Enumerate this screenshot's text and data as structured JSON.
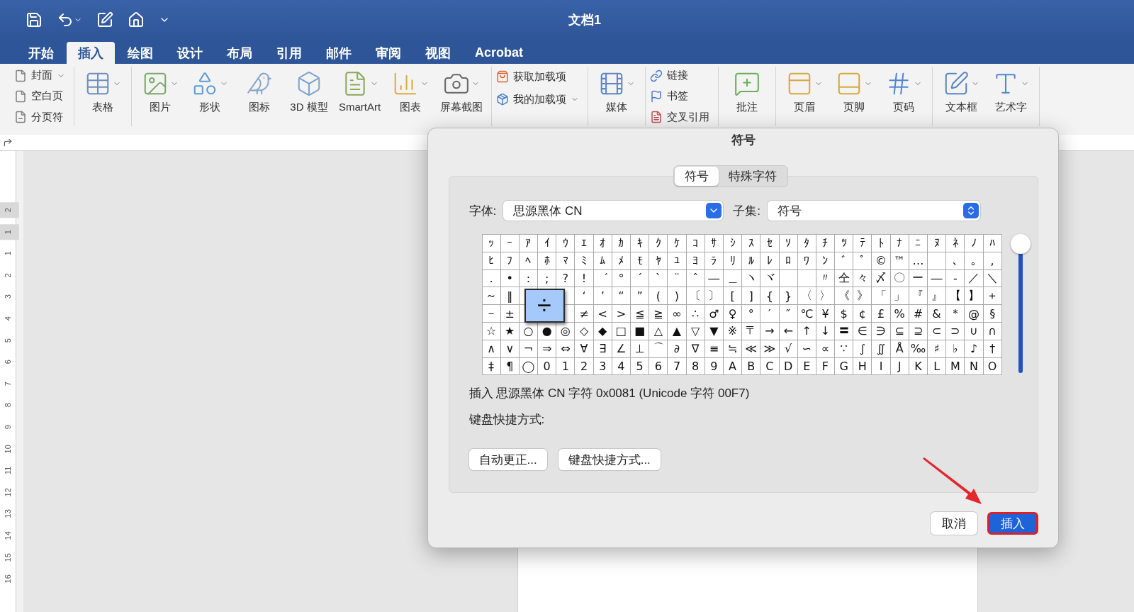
{
  "window": {
    "title": "文档1"
  },
  "menu_tabs": [
    {
      "label": "开始",
      "selected": false
    },
    {
      "label": "插入",
      "selected": true
    },
    {
      "label": "绘图",
      "selected": false
    },
    {
      "label": "设计",
      "selected": false
    },
    {
      "label": "布局",
      "selected": false
    },
    {
      "label": "引用",
      "selected": false
    },
    {
      "label": "邮件",
      "selected": false
    },
    {
      "label": "审阅",
      "selected": false
    },
    {
      "label": "视图",
      "selected": false
    },
    {
      "label": "Acrobat",
      "selected": false
    }
  ],
  "ribbon": {
    "groups": [
      {
        "kind": "stack",
        "items": [
          {
            "label": "封面",
            "dropdown": true
          },
          {
            "label": "空白页",
            "dropdown": false
          },
          {
            "label": "分页符",
            "dropdown": false
          }
        ]
      },
      {
        "kind": "row",
        "items": [
          {
            "label": "表格",
            "dropdown": true
          }
        ]
      },
      {
        "kind": "row",
        "items": [
          {
            "label": "图片",
            "dropdown": true
          },
          {
            "label": "形状",
            "dropdown": true
          },
          {
            "label": "图标",
            "dropdown": false
          },
          {
            "label": "3D 模型",
            "dropdown": false
          },
          {
            "label": "SmartArt",
            "dropdown": true
          },
          {
            "label": "图表",
            "dropdown": true
          },
          {
            "label": "屏幕截图",
            "dropdown": true
          }
        ]
      },
      {
        "kind": "stack",
        "items": [
          {
            "label": "获取加载项",
            "dropdown": false
          },
          {
            "label": "我的加载项",
            "dropdown": true
          }
        ]
      },
      {
        "kind": "row",
        "items": [
          {
            "label": "媒体",
            "dropdown": true
          }
        ]
      },
      {
        "kind": "stack",
        "items": [
          {
            "label": "链接",
            "dropdown": false
          },
          {
            "label": "书签",
            "dropdown": false
          },
          {
            "label": "交叉引用",
            "dropdown": false
          }
        ]
      },
      {
        "kind": "row",
        "items": [
          {
            "label": "批注",
            "dropdown": false
          }
        ]
      },
      {
        "kind": "row",
        "items": [
          {
            "label": "页眉",
            "dropdown": true
          },
          {
            "label": "页脚",
            "dropdown": true
          },
          {
            "label": "页码",
            "dropdown": true
          }
        ]
      },
      {
        "kind": "row",
        "items": [
          {
            "label": "文本框",
            "dropdown": true
          },
          {
            "label": "艺术字",
            "dropdown": true
          }
        ]
      }
    ]
  },
  "vertical_ruler": [
    "2",
    "1",
    "1",
    "2",
    "3",
    "4",
    "5",
    "6",
    "7",
    "8",
    "9",
    "10",
    "11",
    "12",
    "13",
    "14",
    "15",
    "16"
  ],
  "dialog": {
    "title": "符号",
    "tabs": [
      {
        "label": "符号",
        "selected": true
      },
      {
        "label": "特殊字符",
        "selected": false
      }
    ],
    "font": {
      "label": "字体:",
      "value": "思源黑体 CN"
    },
    "subset": {
      "label": "子集:",
      "value": "符号"
    },
    "grid": {
      "magnified": "÷",
      "rows": [
        [
          "ｯ",
          "ｰ",
          "ｱ",
          "ｲ",
          "ｳ",
          "ｴ",
          "ｵ",
          "ｶ",
          "ｷ",
          "ｸ",
          "ｹ",
          "ｺ",
          "ｻ",
          "ｼ",
          "ｽ",
          "ｾ",
          "ｿ",
          "ﾀ",
          "ﾁ",
          "ﾂ",
          "ﾃ",
          "ﾄ",
          "ﾅ",
          "ﾆ",
          "ﾇ",
          "ﾈ",
          "ﾉ",
          "ﾊ"
        ],
        [
          "ﾋ",
          "ﾌ",
          "ﾍ",
          "ﾎ",
          "ﾏ",
          "ﾐ",
          "ﾑ",
          "ﾒ",
          "ﾓ",
          "ﾔ",
          "ﾕ",
          "ﾖ",
          "ﾗ",
          "ﾘ",
          "ﾙ",
          "ﾚ",
          "ﾛ",
          "ﾜ",
          "ﾝ",
          "ﾞ",
          "ﾟ",
          "©",
          "™",
          "…",
          null,
          "､",
          "｡",
          ","
        ],
        [
          ".",
          "•",
          ":",
          ";",
          "?",
          "!",
          "゛",
          "°",
          "´",
          "`",
          "¨",
          "ˆ",
          "―",
          "＿",
          "ヽ",
          "ヾ",
          null,
          null,
          "〃",
          "仝",
          "々",
          "〆",
          "〇",
          "ー",
          "―",
          "‐",
          "／",
          "＼"
        ],
        [
          "～",
          "‖",
          null,
          null,
          null,
          "‘",
          "’",
          "“",
          "”",
          "(",
          ")",
          "〔",
          "〕",
          "[",
          "]",
          "{",
          "}",
          "〈",
          "〉",
          "《",
          "》",
          "「",
          "」",
          "『",
          "』",
          "【",
          "】",
          "＋"
        ],
        [
          "－",
          "±",
          null,
          null,
          null,
          "≠",
          "<",
          ">",
          "≦",
          "≧",
          "∞",
          "∴",
          "♂",
          "♀",
          "°",
          "′",
          "″",
          "℃",
          "¥",
          "$",
          "¢",
          "£",
          "%",
          "#",
          "&",
          "＊",
          "@",
          "§"
        ],
        [
          "☆",
          "★",
          "○",
          "●",
          "◎",
          "◇",
          "◆",
          "□",
          "■",
          "△",
          "▲",
          "▽",
          "▼",
          "※",
          "〒",
          "→",
          "←",
          "↑",
          "↓",
          "〓",
          "∈",
          "∋",
          "⊆",
          "⊇",
          "⊂",
          "⊃",
          "∪",
          "∩"
        ],
        [
          "∧",
          "∨",
          "¬",
          "⇒",
          "⇔",
          "∀",
          "∃",
          "∠",
          "⊥",
          "⌒",
          "∂",
          "∇",
          "≡",
          "≒",
          "≪",
          "≫",
          "√",
          "∽",
          "∝",
          "∵",
          "∫",
          "∬",
          "Å",
          "‰",
          "♯",
          "♭",
          "♪",
          "†"
        ],
        [
          "‡",
          "¶",
          "◯",
          "0",
          "1",
          "2",
          "3",
          "4",
          "5",
          "6",
          "7",
          "8",
          "9",
          "A",
          "B",
          "C",
          "D",
          "E",
          "F",
          "G",
          "H",
          "I",
          "J",
          "K",
          "L",
          "M",
          "N",
          "O"
        ]
      ]
    },
    "info": "插入 思源黑体 CN 字符 0x0081 (Unicode 字符 00F7)",
    "shortcut_label": "键盘快捷方式:",
    "buttons": [
      {
        "label": "自动更正..."
      },
      {
        "label": "键盘快捷方式..."
      }
    ],
    "actions": [
      {
        "label": "取消",
        "primary": false,
        "highlighted": false
      },
      {
        "label": "插入",
        "primary": true,
        "highlighted": true
      }
    ]
  }
}
